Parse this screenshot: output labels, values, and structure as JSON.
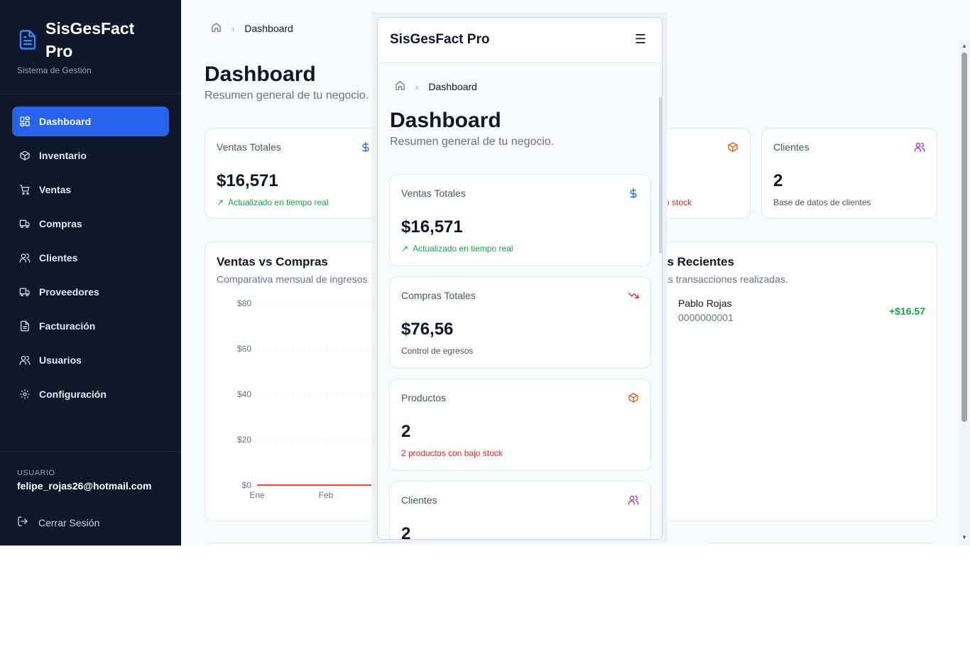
{
  "brand": {
    "title": "SisGesFact Pro",
    "subtitle": "Sistema de Gestión"
  },
  "sidebar": {
    "items": [
      {
        "label": "Dashboard",
        "icon": "grid-icon",
        "active": true
      },
      {
        "label": "Inventario",
        "icon": "box-icon"
      },
      {
        "label": "Ventas",
        "icon": "cart-icon"
      },
      {
        "label": "Compras",
        "icon": "truck-icon"
      },
      {
        "label": "Clientes",
        "icon": "users-icon"
      },
      {
        "label": "Proveedores",
        "icon": "truck-icon"
      },
      {
        "label": "Facturación",
        "icon": "file-icon"
      },
      {
        "label": "Usuarios",
        "icon": "users-icon"
      },
      {
        "label": "Configuración",
        "icon": "gear-icon"
      }
    ],
    "user_label": "USUARIO",
    "user_email": "felipe_rojas26@hotmail.com",
    "logout_label": "Cerrar Sesión"
  },
  "breadcrumb": {
    "current": "Dashboard"
  },
  "page": {
    "title": "Dashboard",
    "subtitle": "Resumen general de tu negocio."
  },
  "stats": {
    "sales": {
      "label": "Ventas Totales",
      "value": "$16,571",
      "note": "Actualizado en tiempo real",
      "icon": "dollar-icon"
    },
    "purchases": {
      "label": "Compras Totales",
      "value": "$76,56",
      "note": "Control de egresos",
      "icon": "trending-down-icon"
    },
    "products": {
      "label": "Productos",
      "value": "2",
      "note": "2 productos con bajo stock",
      "note_partial": "o stock",
      "icon": "package-icon"
    },
    "clients": {
      "label": "Clientes",
      "value": "2",
      "note": "Base de datos de clientes",
      "icon": "users-icon"
    }
  },
  "chart_panel": {
    "title": "Ventas vs Compras",
    "subtitle": "Comparativa mensual de ingresos"
  },
  "chart_data": {
    "type": "line",
    "categories": [
      "Ene",
      "Feb"
    ],
    "ylim": [
      0,
      80
    ],
    "yticks": [
      "$80",
      "$60",
      "$40",
      "$20",
      "$0"
    ],
    "series": [
      {
        "values": [
          0,
          0
        ],
        "color": "#ef4444"
      }
    ],
    "grid": true
  },
  "recent_panel": {
    "title_partial": "as Recientes",
    "subtitle_partial": "las transacciones realizadas.",
    "items": [
      {
        "name": "Pablo Rojas",
        "doc": "0000000001",
        "amount": "+$16.57"
      }
    ]
  },
  "mobile": {
    "title": "SisGesFact Pro",
    "menu_glyph": "☰"
  },
  "colors": {
    "sidebar_bg": "#0f172a",
    "accent": "#2563eb",
    "positive": "#16a34a",
    "negative": "#dc2626",
    "products": "#ea580c",
    "clients": "#9333ea"
  }
}
